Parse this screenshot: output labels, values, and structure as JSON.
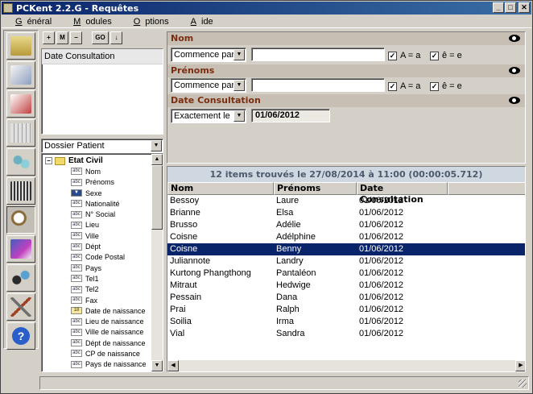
{
  "window": {
    "title": "PCKent 2.2.G - Requêtes"
  },
  "menu": [
    {
      "pre": "",
      "u": "G",
      "post": "énéral"
    },
    {
      "pre": "",
      "u": "M",
      "post": "odules"
    },
    {
      "pre": "",
      "u": "O",
      "post": "ptions"
    },
    {
      "pre": "",
      "u": "A",
      "post": "ide"
    }
  ],
  "toolbar": {
    "go_label": "GO"
  },
  "selected_fields": [
    "Date Consultation"
  ],
  "source_combo": {
    "value": "Dossier Patient"
  },
  "tree": {
    "root": "Etat Civil",
    "items": [
      {
        "label": "Nom",
        "icon": "abc-icon"
      },
      {
        "label": "Prénoms",
        "icon": "abc-icon"
      },
      {
        "label": "Sexe",
        "icon": "list-icon"
      },
      {
        "label": "Nationalité",
        "icon": "abc-icon"
      },
      {
        "label": "N° Social",
        "icon": "abc-icon"
      },
      {
        "label": "Lieu",
        "icon": "abc-icon"
      },
      {
        "label": "Ville",
        "icon": "abc-icon"
      },
      {
        "label": "Dépt",
        "icon": "abc-icon"
      },
      {
        "label": "Code Postal",
        "icon": "abc-icon"
      },
      {
        "label": "Pays",
        "icon": "abc-icon"
      },
      {
        "label": "Tel1",
        "icon": "abc-icon"
      },
      {
        "label": "Tel2",
        "icon": "abc-icon"
      },
      {
        "label": "Fax",
        "icon": "abc-icon"
      },
      {
        "label": "Date de naissance",
        "icon": "calendar-icon"
      },
      {
        "label": "Lieu de naissance",
        "icon": "abc-icon"
      },
      {
        "label": "Ville de naissance",
        "icon": "abc-icon"
      },
      {
        "label": "Dépt de naissance",
        "icon": "abc-icon"
      },
      {
        "label": "CP de naissance",
        "icon": "abc-icon"
      },
      {
        "label": "Pays de naissance",
        "icon": "abc-icon"
      }
    ]
  },
  "filters": {
    "nom": {
      "title": "Nom",
      "operator": "Commence par",
      "value": "",
      "case_label": "A = a",
      "accent_label": "ê = e"
    },
    "prenoms": {
      "title": "Prénoms",
      "operator": "Commence par",
      "value": "",
      "case_label": "A = a",
      "accent_label": "ê = e"
    },
    "date": {
      "title": "Date Consultation",
      "operator": "Exactement le",
      "value": "01/06/2012"
    }
  },
  "results": {
    "header": "12 items trouvés le 27/08/2014 à 11:00 (00:00:05.712)",
    "columns": [
      "Nom",
      "Prénoms",
      "Date Consultation"
    ],
    "rows": [
      [
        "Bessoy",
        "Laure",
        "01/06/2012"
      ],
      [
        "Brianne",
        "Elsa",
        "01/06/2012"
      ],
      [
        "Brusso",
        "Adélie",
        "01/06/2012"
      ],
      [
        "Coisne",
        "Adélphine",
        "01/06/2012"
      ],
      [
        "Coisne",
        "Benny",
        "01/06/2012"
      ],
      [
        "Juliannote",
        "Landry",
        "01/06/2012"
      ],
      [
        "Kurtong Phangthong",
        "Pantaléon",
        "01/06/2012"
      ],
      [
        "Mitraut",
        "Hedwige",
        "01/06/2012"
      ],
      [
        "Pessain",
        "Dana",
        "01/06/2012"
      ],
      [
        "Prai",
        "Ralph",
        "01/06/2012"
      ],
      [
        "Soilia",
        "Irma",
        "01/06/2012"
      ],
      [
        "Vial",
        "Sandra",
        "01/06/2012"
      ]
    ],
    "selected_index": 4
  }
}
